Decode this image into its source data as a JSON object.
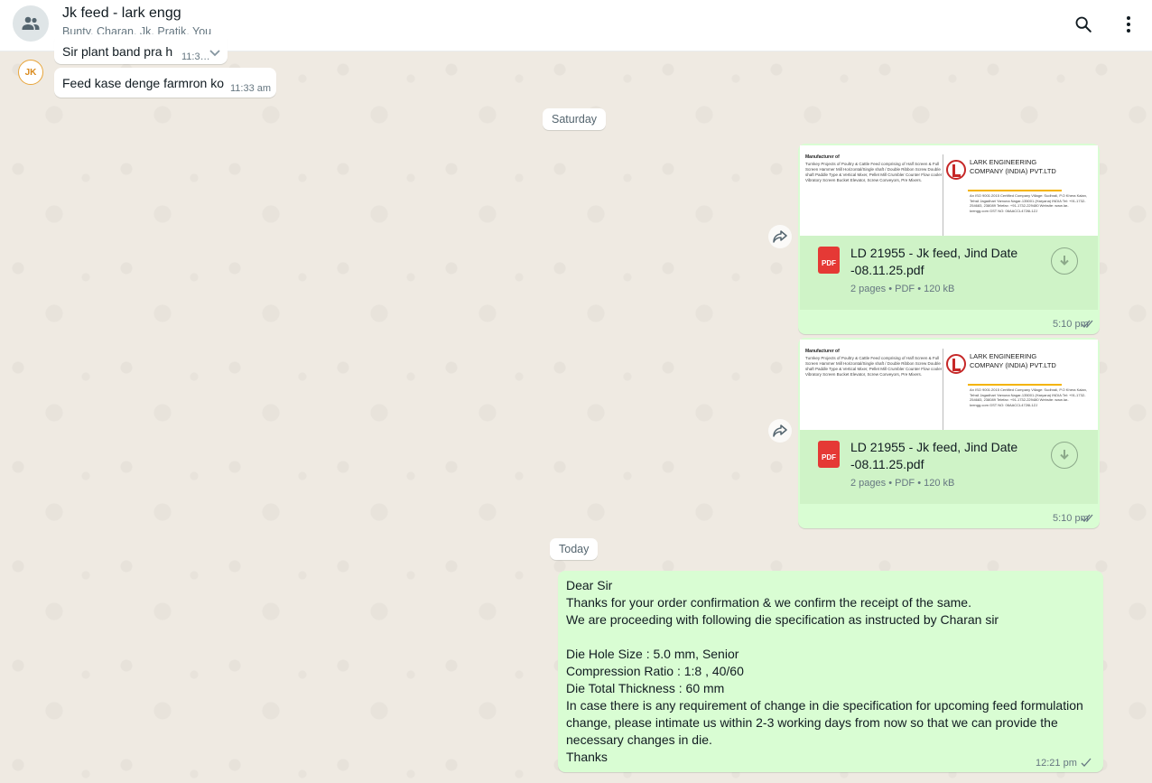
{
  "header": {
    "title": "Jk feed - lark engg",
    "members": "Bunty, Charan, Jk, Pratik, You"
  },
  "incoming": [
    {
      "text": "Sir plant band pra h",
      "time": "11:3…"
    },
    {
      "text": "Feed kase denge farmron ko",
      "time": "11:33 am"
    }
  ],
  "sender_avatar_label": "JK",
  "date_chips": {
    "saturday": "Saturday",
    "today": "Today"
  },
  "documents": [
    {
      "file_name": "LD 21955 - Jk feed, Jind Date -08.11.25.pdf",
      "pages": "2 pages",
      "type": "PDF",
      "size": "120 kB",
      "time": "5:10 pm",
      "icon_label": "PDF",
      "preview": {
        "heading": "Manufacturer of",
        "body": "Turnkey Projects of Poultry & Cattle Feed comprising of Half Screen & Full Screen Hammer Mill Horizontal/Single shaft / Double Ribbon Screw Double shaft Paddle Type & Vertical Mixer, Pellet Mill Crumbler Counter Flow cooler Vibratory Screen Bucket Elevator, Screw Conveyors, Pre Mixers.",
        "company": "LARK ENGINEERING COMPANY (INDIA) PVT.LTD",
        "address": "An ISO 9001:2015 Certified Company Village: Sudhrali, P.O Khera Kalan, Tehsil Jagadhari Yamuna Nagar-135001 (Haryana) INDIA Tel: +91-1732-254683, 238089 Telefax: +91-1732-229480 Website: www.lar-krengg.com GST NO: 06AACCL4726L1ZJ"
      }
    },
    {
      "file_name": "LD 21955 - Jk feed, Jind Date -08.11.25.pdf",
      "pages": "2 pages",
      "type": "PDF",
      "size": "120 kB",
      "time": "5:10 pm",
      "icon_label": "PDF",
      "preview": {
        "heading": "Manufacturer of",
        "body": "Turnkey Projects of Poultry & Cattle Feed comprising of Half Screen & Full Screen Hammer Mill Horizontal/Single shaft / Double Ribbon Screw Double shaft Paddle Type & Vertical Mixer, Pellet Mill Crumbler Counter Flow cooler Vibratory Screen Bucket Elevator, Screw Conveyors, Pre Mixers.",
        "company": "LARK ENGINEERING COMPANY (INDIA) PVT.LTD",
        "address": "An ISO 9001:2015 Certified Company Village: Sudhrali, P.O Khera Kalan, Tehsil Jagadhari Yamuna Nagar-135001 (Haryana) INDIA Tel: +91-1732-254683, 238089 Telefax: +91-1732-229480 Website: www.lar-krengg.com GST NO: 06AACCL4726L1ZJ"
      }
    }
  ],
  "meta_separator": "•",
  "outgoing_text": {
    "text": "Dear Sir\nThanks for your order confirmation & we confirm the receipt of the same.\nWe are proceeding with following die specification as instructed by Charan sir\n\nDie Hole Size : 5.0 mm, Senior\nCompression Ratio : 1:8 , 40/60\nDie Total Thickness : 60 mm\nIn case there is any requirement of change in die specification for upcoming feed formulation change, please intimate us within 2-3 working days from now so that we can provide the necessary changes in die.\nThanks",
    "time": "12:21 pm"
  },
  "colors": {
    "outgoing_bubble": "#d9fdd3",
    "incoming_bubble": "#ffffff",
    "background": "#efeae2",
    "read_tick": "#667781"
  }
}
